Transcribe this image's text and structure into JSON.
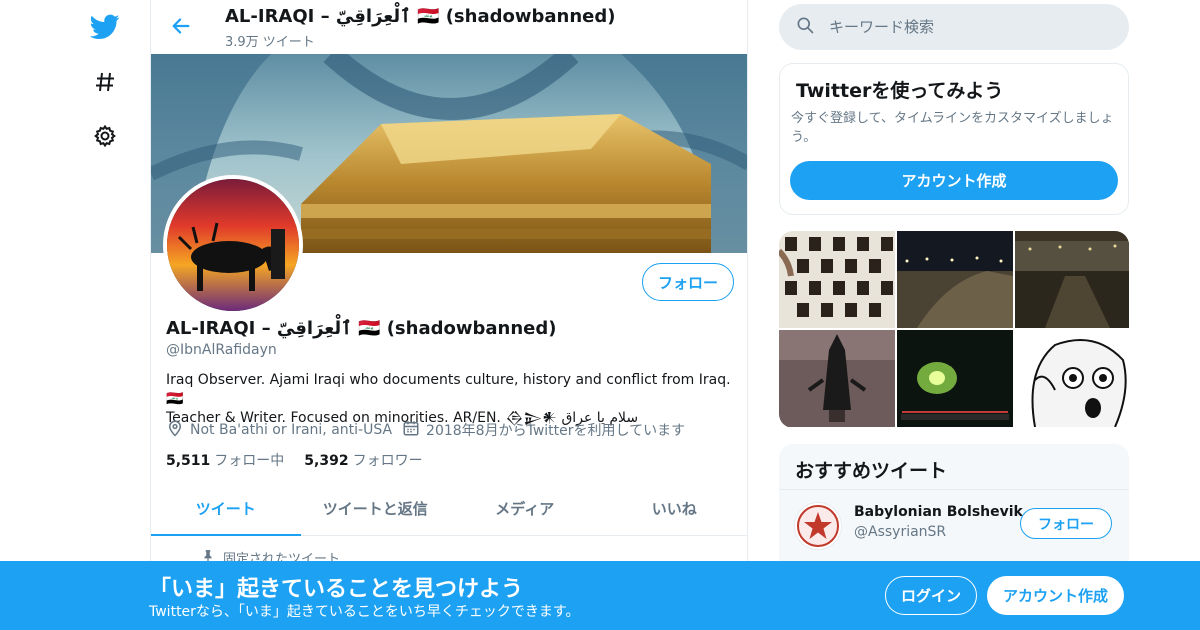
{
  "nav": {
    "icons": [
      "twitter-bird-icon",
      "hashtag-icon",
      "gear-icon"
    ]
  },
  "header": {
    "title": "AL-IRAQI – ٱلْعِرَاقِيّ 🇮🇶 (shadowbanned)",
    "tweet_count": "3.9万 ツイート"
  },
  "profile": {
    "name": "AL-IRAQI – ٱلْعِرَاقِيّ 🇮🇶 (shadowbanned)",
    "handle": "@IbnAlRafidayn",
    "bio_line1": "Iraq Observer. Ajami Iraqi who documents culture, history and conflict from Iraq.🇮🇶",
    "bio_line2": " Teacher & Writer. Focused on minorities. AR/EN. 𒁲𒉌𒀭 سلام يا عراق",
    "location": "Not Ba'athi or Irani, anti-USA",
    "joined": "2018年8月からTwitterを利用しています",
    "follow_label": "フォロー",
    "following_count": "5,511",
    "following_label": "フォロー中",
    "followers_count": "5,392",
    "followers_label": "フォロワー"
  },
  "tabs": [
    "ツイート",
    "ツイートと返信",
    "メディア",
    "いいね"
  ],
  "active_tab": 0,
  "pinned_label": "固定されたツイート",
  "search": {
    "placeholder": "キーワード検索"
  },
  "signup_card": {
    "title": "Twitterを使ってみよう",
    "description": "今すぐ登録して、タイムラインをカスタマイズしましょう。",
    "button": "アカウント作成"
  },
  "recommended": {
    "title": "おすすめツイート",
    "items": [
      {
        "name": "Babylonian Bolshevik",
        "handle": "@AssyrianSR",
        "follow_label": "フォロー"
      }
    ]
  },
  "bottom_bar": {
    "title": "「いま」起きていることを見つけよう",
    "subtitle": "Twitterなら、「いま」起きていることをいち早くチェックできます。",
    "login": "ログイン",
    "signup": "アカウント作成"
  },
  "colors": {
    "accent": "#1da1f2",
    "text": "#14171a",
    "secondary_text": "#657786",
    "border": "#e6ecf0"
  }
}
